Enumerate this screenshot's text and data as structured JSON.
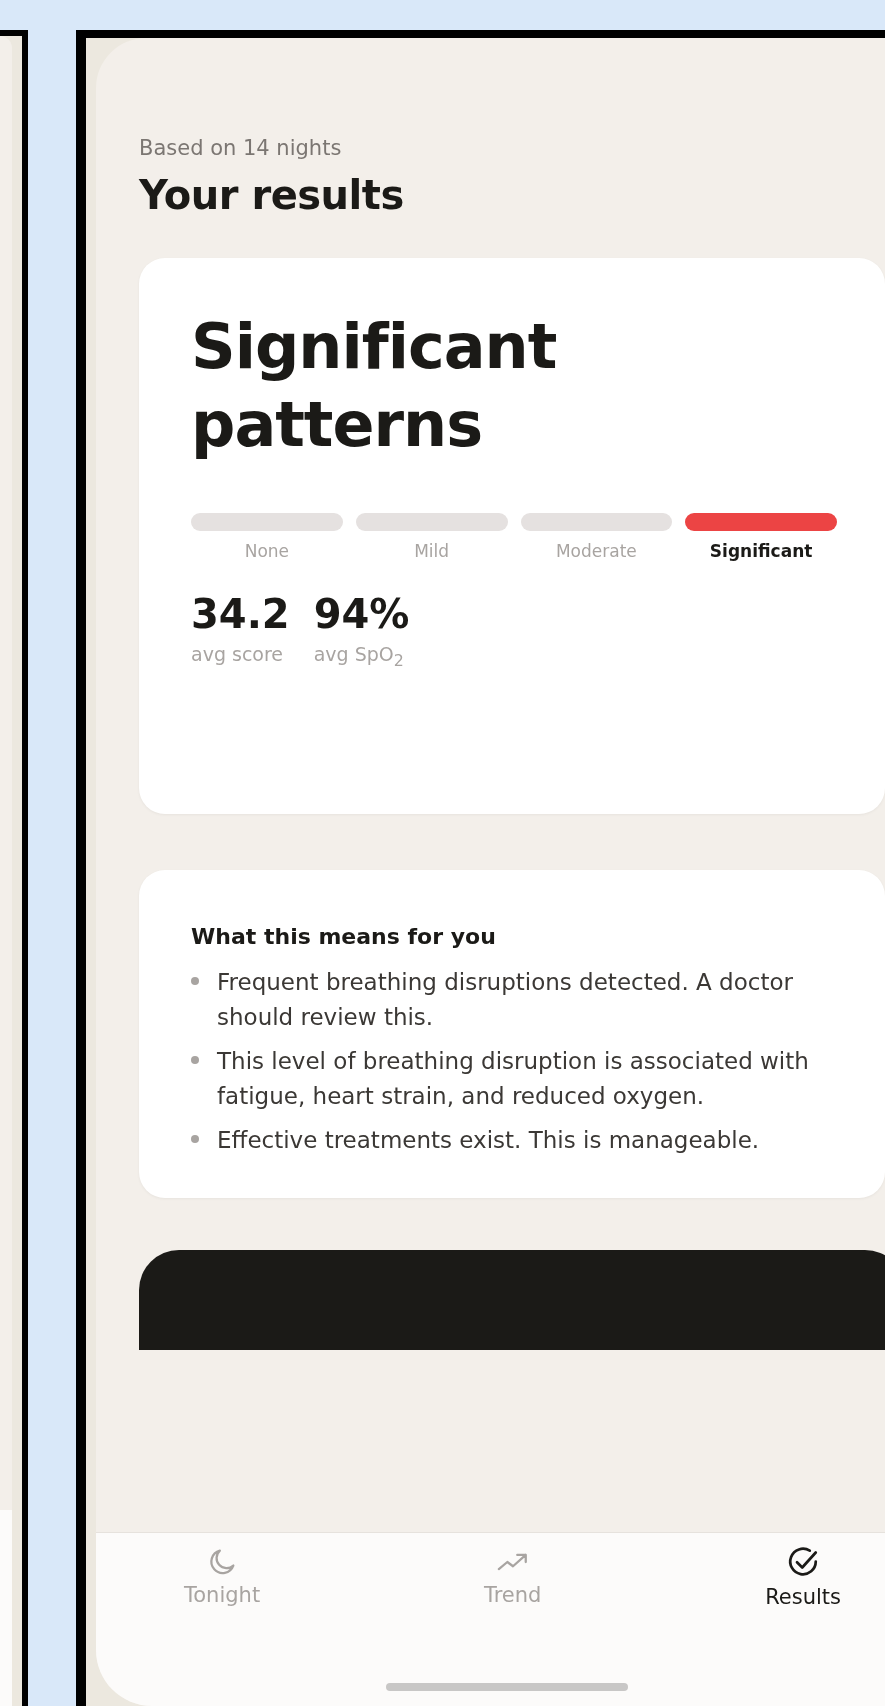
{
  "header": {
    "subtitle": "Based on 14 nights",
    "title": "Your results"
  },
  "summary_card": {
    "headline": "Significant patterns",
    "severity": [
      {
        "label": "None",
        "selected": false
      },
      {
        "label": "Mild",
        "selected": false
      },
      {
        "label": "Moderate",
        "selected": false
      },
      {
        "label": "Significant",
        "selected": true
      }
    ],
    "stats": [
      {
        "value": "34.2",
        "label": "avg score"
      },
      {
        "value": "94%",
        "label": "avg SpO$_{2}$"
      }
    ]
  },
  "info_card": {
    "heading": "What this means for you",
    "bullets": [
      "Frequent breathing disruptions detected. A doctor should review this.",
      "This level of breathing disruption is associated with fatigue, heart strain, and reduced oxygen.",
      "Effective treatments exist. This is manageable."
    ]
  },
  "tab_bar": [
    {
      "label": "Tonight",
      "selected": false
    },
    {
      "label": "Trend",
      "selected": false
    },
    {
      "label": "Results",
      "selected": true
    }
  ]
}
